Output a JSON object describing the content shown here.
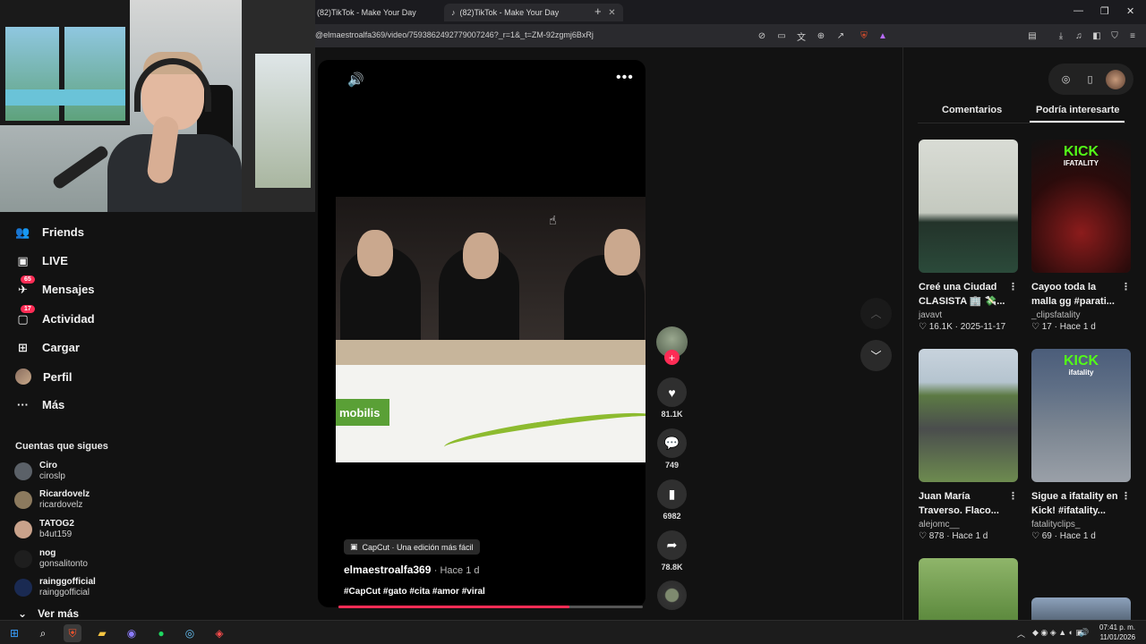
{
  "browser": {
    "tabs": [
      {
        "title": "(82)TikTok - Make Your Day"
      },
      {
        "title": "(82)TikTok - Make Your Day"
      }
    ],
    "url": "@elmaestroalfa369/video/7593862492779007246?_r=1&_t=ZM-92zgmj6BxRj",
    "window_controls": [
      "—",
      "❐",
      "✕"
    ]
  },
  "sidebar": {
    "items": [
      {
        "label": "Friends",
        "icon": "friends-icon"
      },
      {
        "label": "LIVE",
        "icon": "live-icon"
      },
      {
        "label": "Mensajes",
        "icon": "messages-icon",
        "badge": "65"
      },
      {
        "label": "Actividad",
        "icon": "activity-icon",
        "badge": "17"
      },
      {
        "label": "Cargar",
        "icon": "upload-icon"
      },
      {
        "label": "Perfil",
        "icon": "profile-icon"
      },
      {
        "label": "Más",
        "icon": "more-icon"
      }
    ],
    "following_title": "Cuentas que sigues",
    "following": [
      {
        "name": "Ciro",
        "handle": "ciroslp"
      },
      {
        "name": "Ricardovelz",
        "handle": "ricardovelz"
      },
      {
        "name": "TATOG2",
        "handle": "b4ut159"
      },
      {
        "name": "nog",
        "handle": "gonsalitonto"
      },
      {
        "name": "rainggofficial",
        "handle": "rainggofficial"
      }
    ],
    "see_more": "Ver más"
  },
  "video": {
    "capcut_label": "CapCut · Una edición más fácil",
    "author": "elmaestroalfa369",
    "time": "· Hace 1 d",
    "hashtags": "#CapCut #gato #cita #amor #viral",
    "progress": 0.76,
    "banner_text": "mobilis",
    "actions": {
      "likes": "81.1K",
      "comments": "749",
      "saves": "6982",
      "shares": "78.8K"
    }
  },
  "right_panel": {
    "tabs": [
      "Comentarios",
      "Podría interesarte"
    ],
    "active_tab": "Podría interesarte",
    "cards": [
      {
        "title": "Creé una Ciudad CLASISTA 🏢 💸...",
        "user": "javavt",
        "likes": "16.1K",
        "date": "2025-11-17"
      },
      {
        "title": "Cayoo toda la malla gg #parati...",
        "user": "_clipsfatality",
        "likes": "17",
        "date": "Hace 1 d",
        "kick": "KICK",
        "kick_sub": "IFATALITY"
      },
      {
        "title": "Juan María Traverso. Flaco...",
        "user": "alejomc__",
        "likes": "878",
        "date": "Hace 1 d"
      },
      {
        "title": "Sigue a ifatality en Kick! #ifatality...",
        "user": "fatalityclips_",
        "likes": "69",
        "date": "Hace 1 d",
        "kick": "KICK",
        "kick_sub": "ifatality"
      }
    ]
  },
  "taskbar": {
    "time": "07:41 p. m.",
    "date": "11/01/2026"
  },
  "colors": {
    "accent": "#fe2c55",
    "kick_green": "#53fc18",
    "background": "#121212"
  }
}
